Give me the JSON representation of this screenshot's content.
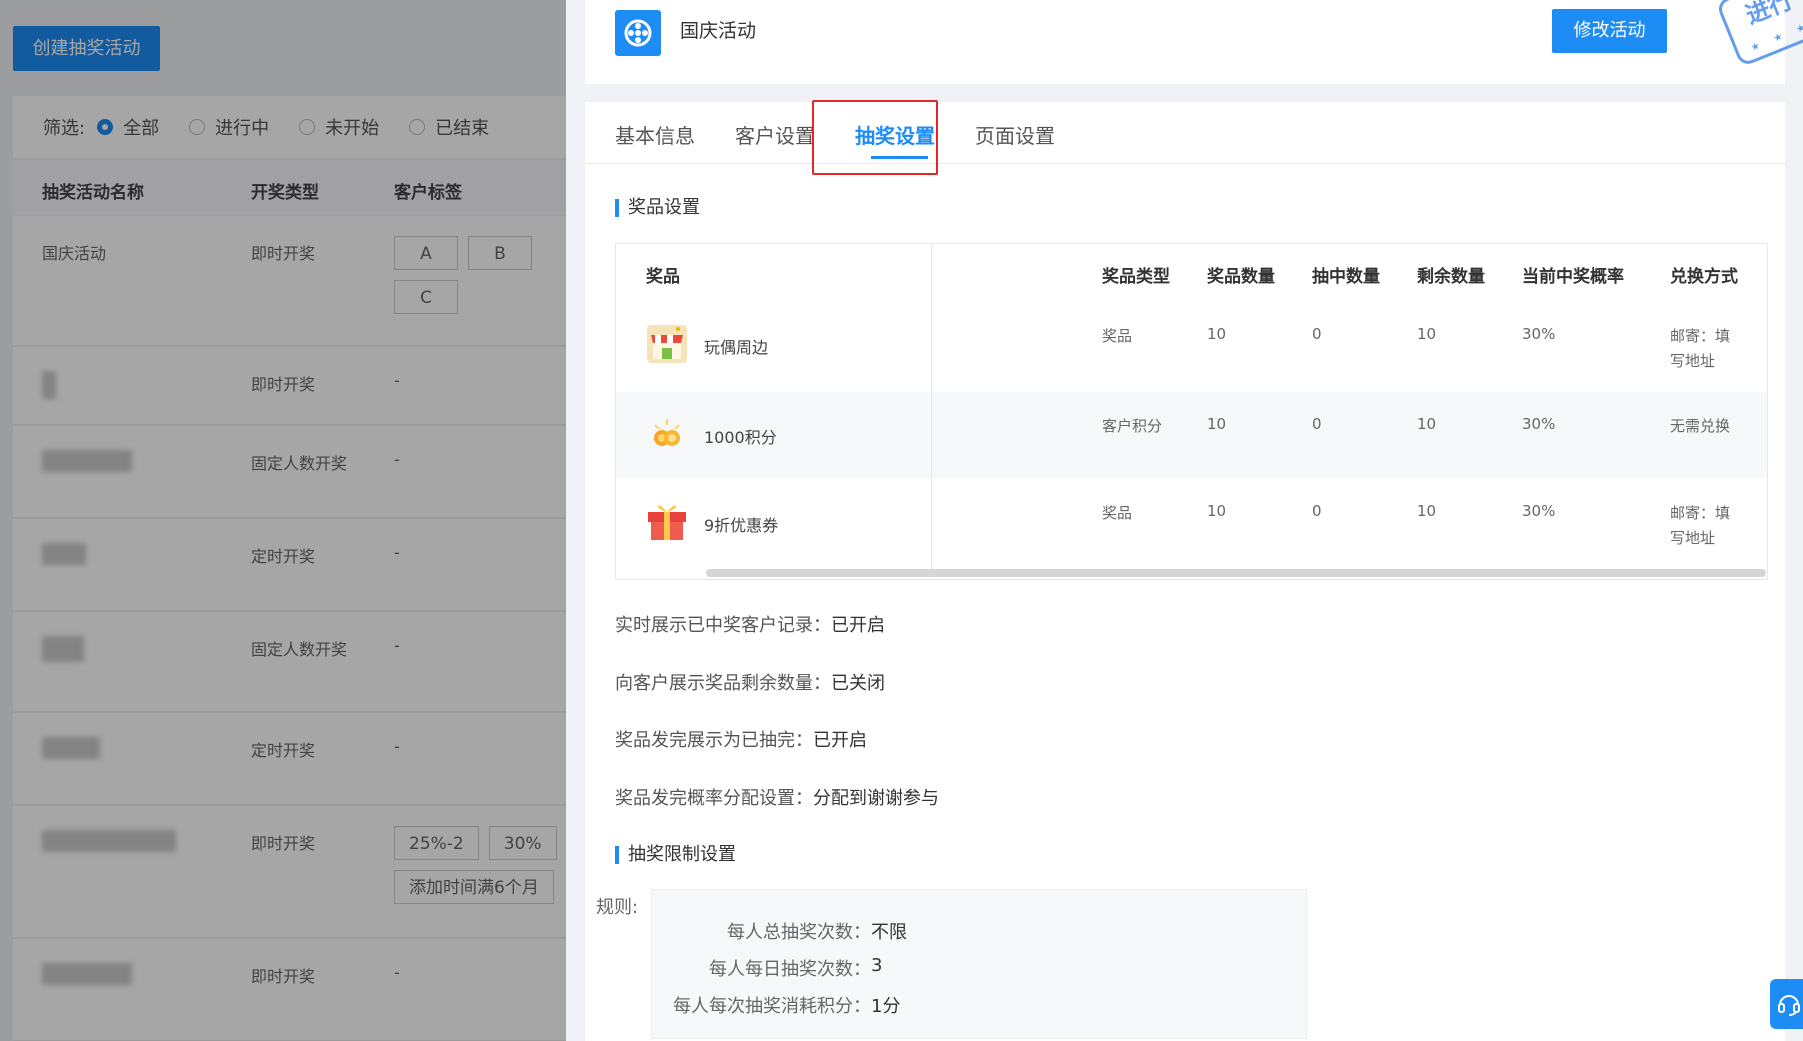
{
  "background": {
    "create_button": "创建抽奖活动",
    "filter_label": "筛选:",
    "filter_options": [
      "全部",
      "进行中",
      "未开始",
      "已结束"
    ],
    "columns": [
      "抽奖活动名称",
      "开奖类型",
      "客户标签"
    ],
    "rows": [
      {
        "name": "国庆活动",
        "type": "即时开奖",
        "tags": [
          "A",
          "B",
          "C"
        ]
      },
      {
        "name": "",
        "type": "即时开奖",
        "tag_text": "-"
      },
      {
        "name": "",
        "type": "固定人数开奖",
        "tag_text": "-"
      },
      {
        "name": "",
        "type": "定时开奖",
        "tag_text": "-"
      },
      {
        "name": "",
        "type": "固定人数开奖",
        "tag_text": "-"
      },
      {
        "name": "",
        "type": "定时开奖",
        "tag_text": "-"
      },
      {
        "name": "",
        "type": "即时开奖",
        "tags": [
          "25%-2",
          "30%",
          "添加时间满6个月"
        ]
      },
      {
        "name": "",
        "type": "即时开奖",
        "tag_text": "-"
      }
    ]
  },
  "drawer": {
    "title": "国庆活动",
    "edit_button": "修改活动",
    "stamp_text": "进行",
    "tabs": [
      "基本信息",
      "客户设置",
      "抽奖设置",
      "页面设置"
    ],
    "active_tab_index": 2,
    "prize_section_title": "奖品设置",
    "prize_columns": {
      "prize": "奖品",
      "type": "奖品类型",
      "quantity": "奖品数量",
      "won": "抽中数量",
      "remaining": "剩余数量",
      "probability": "当前中奖概率",
      "redeem": "兑换方式"
    },
    "prizes": [
      {
        "name": "玩偶周边",
        "icon": "shop-icon",
        "type": "奖品",
        "quantity": "10",
        "won": "0",
        "remaining": "10",
        "probability": "30%",
        "redeem_line1": "邮寄：填",
        "redeem_line2": "写地址"
      },
      {
        "name": "1000积分",
        "icon": "coins-icon",
        "type": "客户积分",
        "quantity": "10",
        "won": "0",
        "remaining": "10",
        "probability": "30%",
        "redeem_line1": "无需兑换",
        "redeem_line2": ""
      },
      {
        "name": "9折优惠券",
        "icon": "gift-icon",
        "type": "奖品",
        "quantity": "10",
        "won": "0",
        "remaining": "10",
        "probability": "30%",
        "redeem_line1": "邮寄：填",
        "redeem_line2": "写地址"
      }
    ],
    "settings": [
      {
        "label": "实时展示已中奖客户记录：",
        "value": "已开启"
      },
      {
        "label": "向客户展示奖品剩余数量：",
        "value": "已关闭"
      },
      {
        "label": "奖品发完展示为已抽完：",
        "value": "已开启"
      },
      {
        "label": "奖品发完概率分配设置：",
        "value": "分配到谢谢参与"
      }
    ],
    "limit_section_title": "抽奖限制设置",
    "rules_label": "规则:",
    "rules": [
      {
        "label": "每人总抽奖次数：",
        "value": "不限"
      },
      {
        "label": "每人每日抽奖次数：",
        "value": "3"
      },
      {
        "label": "每人每次抽奖消耗积分：",
        "value": "1分"
      }
    ]
  },
  "colors": {
    "accent": "#1e8cf5",
    "highlight": "#e5262b"
  }
}
